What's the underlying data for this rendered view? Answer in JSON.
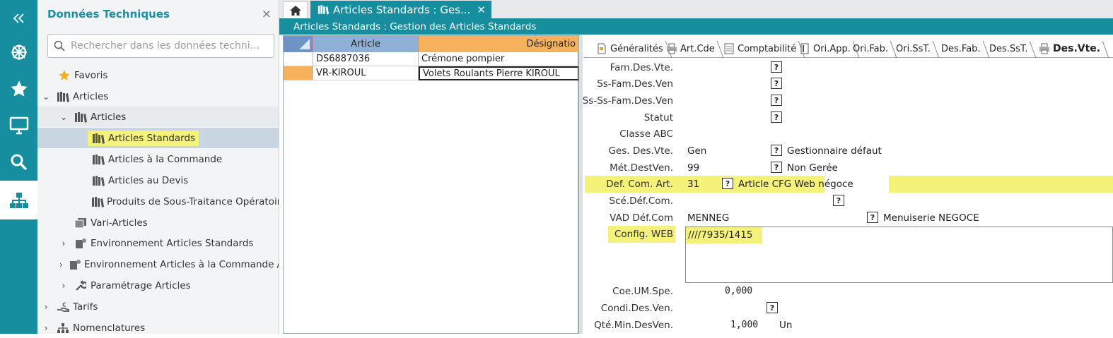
{
  "tree": {
    "title": "Données Techniques",
    "close": "×",
    "search_placeholder": "Rechercher dans les données techni...",
    "items": [
      {
        "label": "Favoris"
      },
      {
        "label": "Articles"
      },
      {
        "label": "Articles"
      },
      {
        "label": "Articles Standards"
      },
      {
        "label": "Articles à la Commande"
      },
      {
        "label": "Articles au Devis"
      },
      {
        "label": "Produits de Sous-Traitance Opératoir"
      },
      {
        "label": "Vari-Articles"
      },
      {
        "label": "Environnement Articles Standards"
      },
      {
        "label": "Environnement Articles à la Commande /"
      },
      {
        "label": "Paramétrage Articles"
      },
      {
        "label": "Tarifs"
      },
      {
        "label": "Nomenclatures"
      }
    ]
  },
  "tabs": {
    "doc_tab": "Articles Standards : Ges...",
    "close": "✕"
  },
  "window_title": "Articles Standards : Gestion des Articles Standards",
  "grid": {
    "columns": [
      "Article",
      "Désignatio"
    ],
    "rows": [
      {
        "article": "DS6887036",
        "designation": "Crémone pompier"
      },
      {
        "article": "VR-KIROUL",
        "designation": "Volets Roulants Pierre KIROUL"
      }
    ]
  },
  "form_tabs": [
    "Généralités",
    "Art.Cde",
    "Comptabilité",
    "Ori.App.",
    "Ori.Fab.",
    "Ori.SsT.",
    "Des.Fab.",
    "Des.SsT.",
    "Des.Vte."
  ],
  "form": {
    "fam_des_vte": "Fam.Des.Vte.",
    "ss_fam": "Ss-Fam.Des.Ven",
    "ss_ss_fam": "Ss-Ss-Fam.Des.Ven",
    "statut": "Statut",
    "classe_abc": "Classe ABC",
    "ges_des_vte": "Ges. Des.Vte.",
    "ges_des_vte_val": "Gen",
    "ges_des_vte_desc": "Gestionnaire défaut",
    "met_dest_ven": "Mét.DestVen.",
    "met_dest_ven_val": "99",
    "met_dest_ven_desc": "Non Gerée",
    "def_com_art": "Def. Com. Art.",
    "def_com_art_val": "31",
    "def_com_art_desc": "Article CFG Web négoce",
    "sce_def_com": "Scé.Déf.Com.",
    "vad_def_com": "VAD Déf.Com",
    "vad_def_com_val": "MENNEG",
    "vad_def_com_desc": "Menuiserie NEGOCE",
    "config_web": "Config. WEB",
    "config_web_val": "////7935/1415",
    "coe_um_spe": "Coe.UM.Spe.",
    "coe_um_spe_val": "0,000",
    "condi_des_ven": "Condi.Des.Ven.",
    "qte_min_des_ven": "Qté.Min.DesVen.",
    "qte_min_des_ven_val": "1,000",
    "qte_unit": "Un",
    "q": "?"
  },
  "colors": {
    "accent": "#168ea0",
    "highlight": "#f4f27a",
    "grid_header": "#f6b15c"
  }
}
